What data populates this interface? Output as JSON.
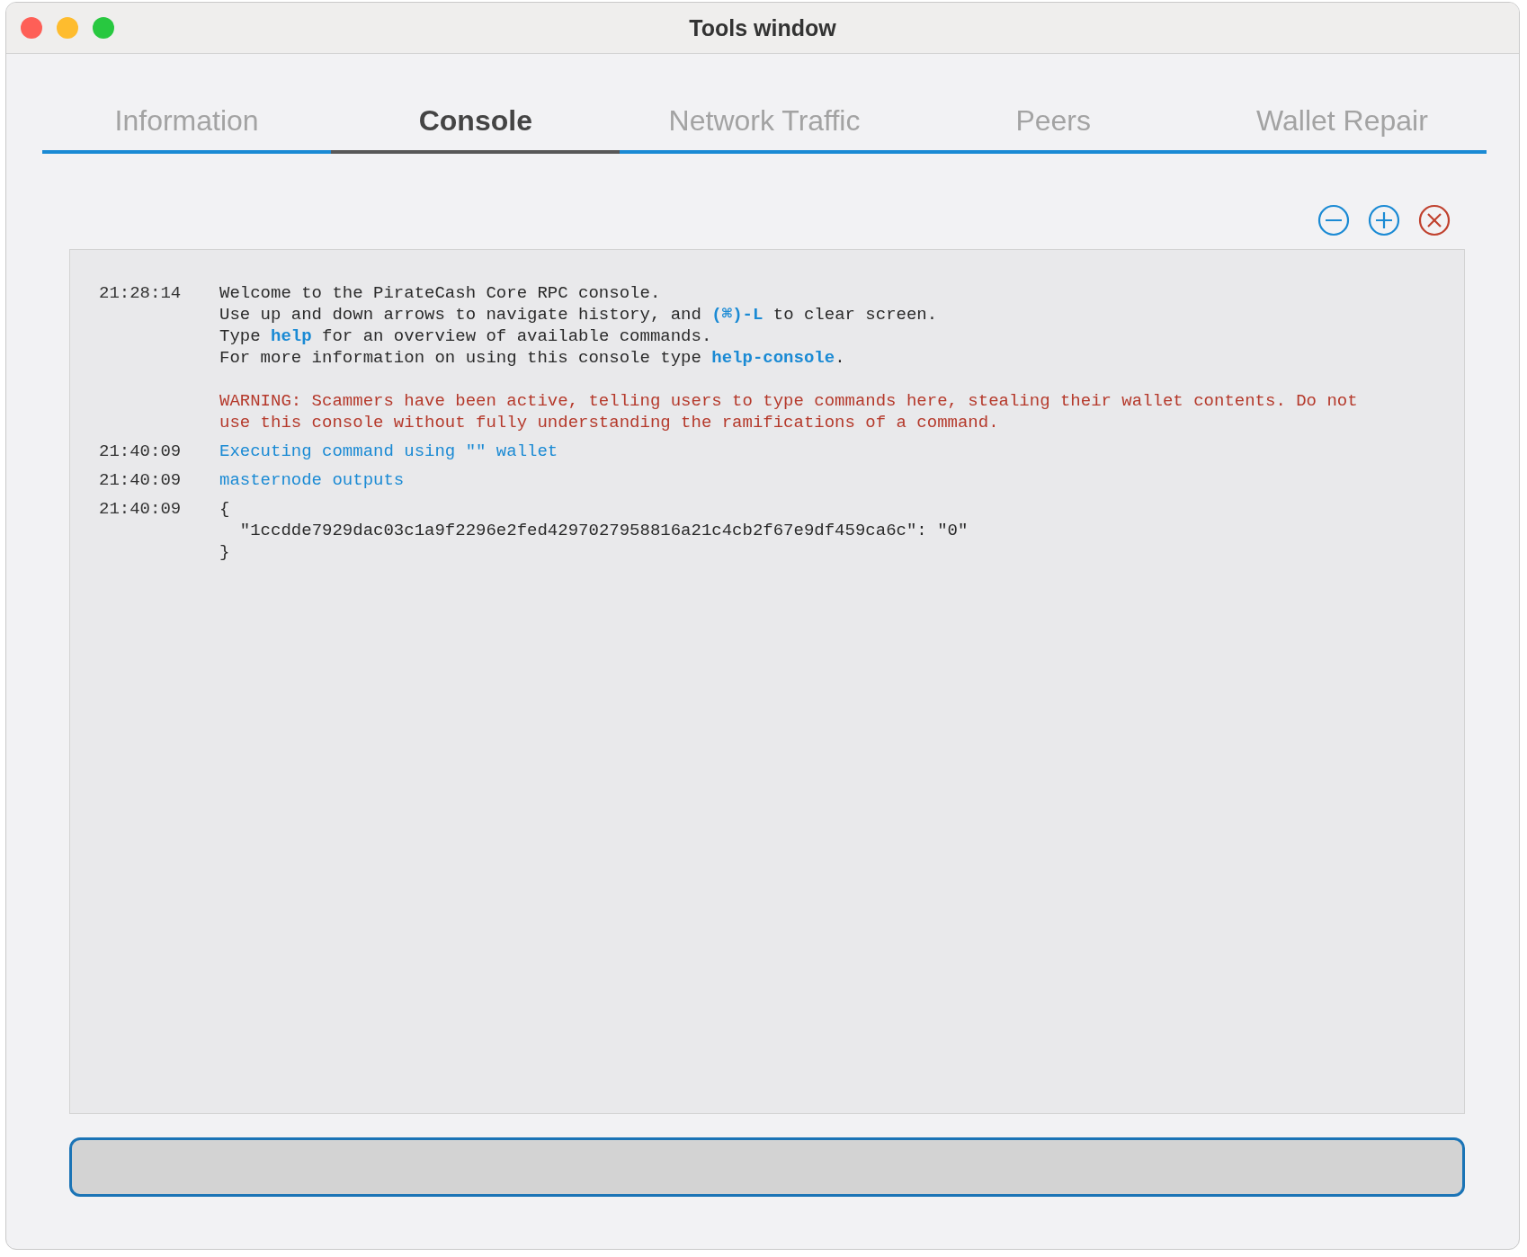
{
  "window": {
    "title": "Tools window"
  },
  "tabs": [
    {
      "label": "Information",
      "selected": false
    },
    {
      "label": "Console",
      "selected": true
    },
    {
      "label": "Network Traffic",
      "selected": false
    },
    {
      "label": "Peers",
      "selected": false
    },
    {
      "label": "Wallet Repair",
      "selected": false
    }
  ],
  "toolbar": [
    {
      "kind": "zoom-out"
    },
    {
      "kind": "zoom-in"
    },
    {
      "kind": "clear"
    }
  ],
  "console": {
    "entries": [
      {
        "time": "21:28:14",
        "lines": [
          {
            "kind": "text",
            "parts": [
              {
                "text": "Welcome to the PirateCash Core RPC console."
              }
            ]
          },
          {
            "kind": "text",
            "parts": [
              {
                "text": "Use up and down arrows to navigate history, and "
              },
              {
                "text": "(⌘)-L",
                "kind": "key"
              },
              {
                "text": " to clear screen."
              }
            ]
          },
          {
            "kind": "text",
            "parts": [
              {
                "text": "Type "
              },
              {
                "text": "help",
                "kind": "key"
              },
              {
                "text": " for an overview of available commands."
              }
            ]
          },
          {
            "kind": "text",
            "parts": [
              {
                "text": "For more information on using this console type "
              },
              {
                "text": "help-console",
                "kind": "key"
              },
              {
                "text": "."
              }
            ]
          },
          {
            "kind": "warning",
            "parts": [
              {
                "text": "WARNING: Scammers have been active, telling users to type commands here, stealing their wallet contents. Do not use this console without fully understanding the ramifications of a command."
              }
            ]
          }
        ]
      },
      {
        "time": "21:40:09",
        "lines": [
          {
            "kind": "command",
            "parts": [
              {
                "text": "Executing command using \"\" wallet"
              }
            ]
          }
        ]
      },
      {
        "time": "21:40:09",
        "lines": [
          {
            "kind": "command",
            "parts": [
              {
                "text": "masternode outputs"
              }
            ]
          }
        ]
      },
      {
        "time": "21:40:09",
        "lines": [
          {
            "kind": "text",
            "parts": [
              {
                "text": "{"
              }
            ]
          },
          {
            "kind": "text",
            "parts": [
              {
                "text": "  \"1ccdde7929dac03c1a9f2296e2fed4297027958816a21c4cb2f67e9df459ca6c\": \"0\""
              }
            ]
          },
          {
            "kind": "text",
            "parts": [
              {
                "text": "}"
              }
            ]
          }
        ]
      }
    ]
  }
}
